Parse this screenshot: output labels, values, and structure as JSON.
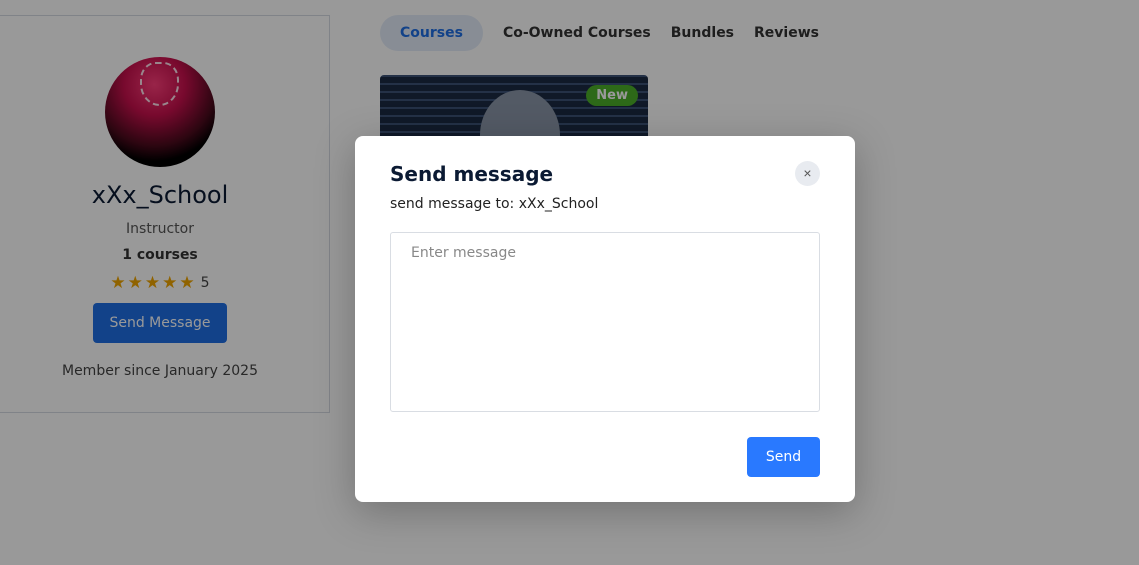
{
  "profile": {
    "name": "xXx_School",
    "role": "Instructor",
    "courses": "1 courses",
    "rating": "5",
    "stars": 5,
    "send_message_label": "Send Message",
    "member_since": "Member since January 2025"
  },
  "tabs": [
    {
      "label": "Courses",
      "active": true
    },
    {
      "label": "Co-Owned Courses"
    },
    {
      "label": "Bundles"
    },
    {
      "label": "Reviews"
    }
  ],
  "course_card": {
    "badge": "New"
  },
  "modal": {
    "title": "Send message",
    "recipient_text": "send message to: xXx_School",
    "message_placeholder": "Enter message",
    "message_value": "",
    "send_label": "Send",
    "close_icon": "×"
  },
  "colors": {
    "primary": "#2979ff",
    "badge": "#4caf28",
    "star": "#f0a500"
  }
}
